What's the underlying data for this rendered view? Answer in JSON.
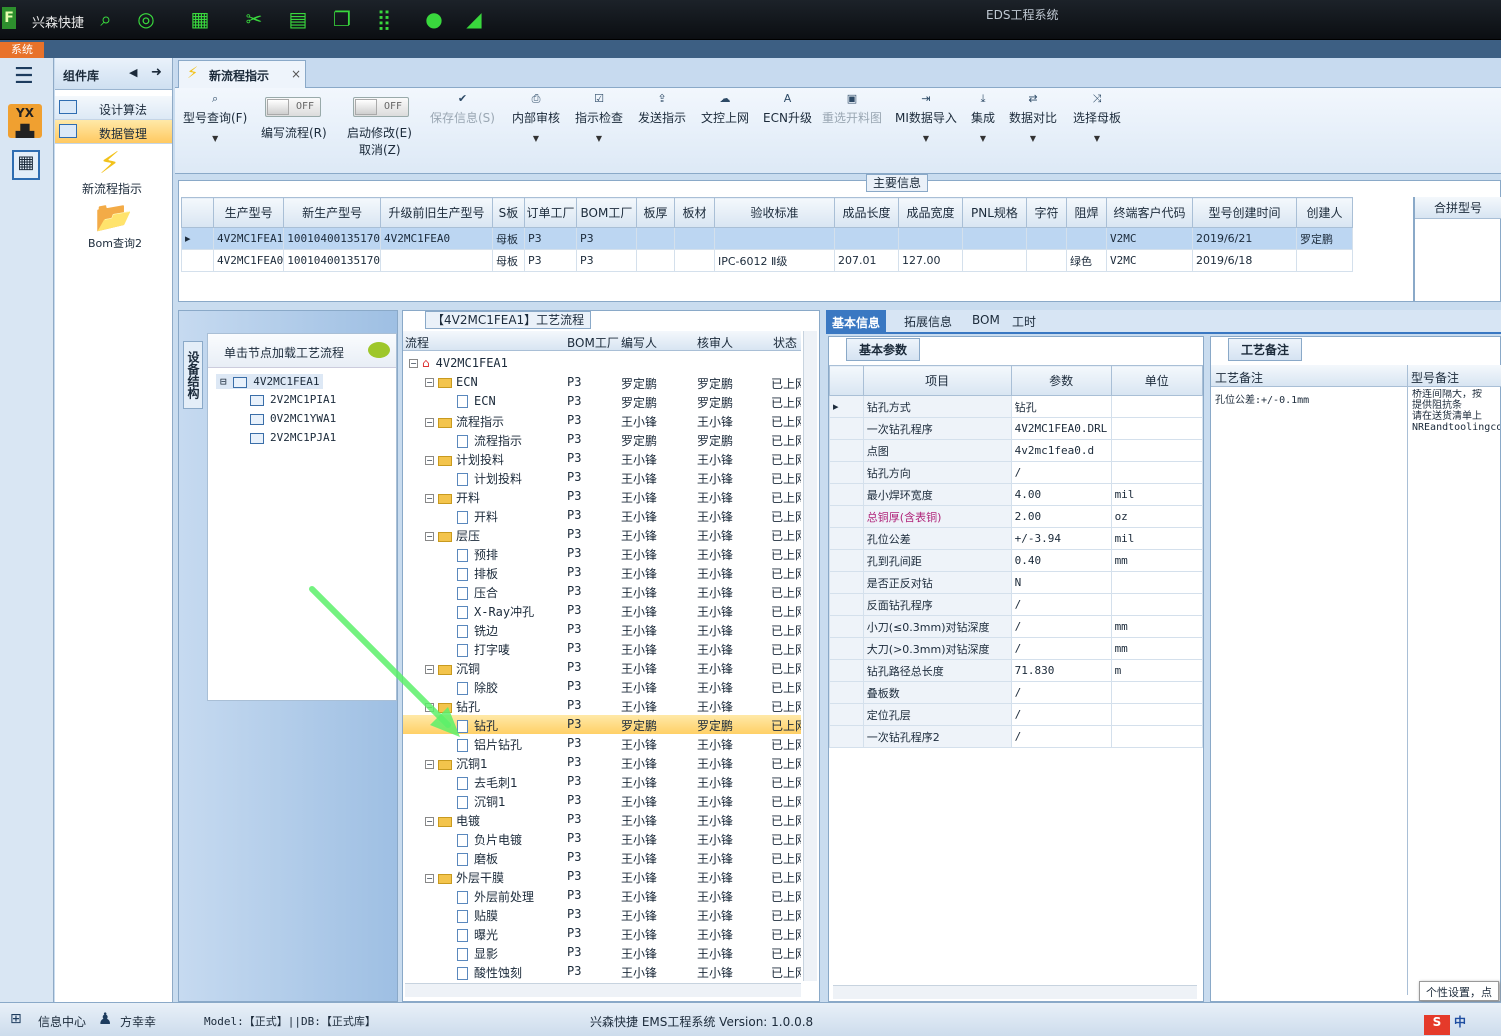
{
  "titlebar": {
    "app_name": "兴森快捷",
    "window_title": "EDS工程系统",
    "logo": "F"
  },
  "system_tab": "系统",
  "library": {
    "title": "组件库",
    "items": [
      {
        "label": "设计算法"
      },
      {
        "label": "数据管理"
      }
    ],
    "big_items": [
      {
        "label": "新流程指示"
      },
      {
        "label": "Bom查询2"
      }
    ]
  },
  "doc_tab": {
    "label": "新流程指示",
    "close": "×"
  },
  "toolbar": {
    "buttons": [
      {
        "label": "型号查询(F)",
        "icon": "search-icon"
      },
      {
        "label": "编写流程(R)",
        "toggle": "OFF"
      },
      {
        "label": "启动修改(E)",
        "label2": "取消(Z)",
        "toggle": "OFF"
      },
      {
        "label": "保存信息(S)",
        "icon": "check-icon",
        "disabled": true
      },
      {
        "label": "内部审核",
        "icon": "printer-icon"
      },
      {
        "label": "指示检查",
        "icon": "checkbox-icon"
      },
      {
        "label": "发送指示",
        "icon": "upload-icon"
      },
      {
        "label": "文控上网",
        "icon": "cloud-upload-icon"
      },
      {
        "label": "ECN升级",
        "icon": "font-a-icon"
      },
      {
        "label": "重选开料图",
        "icon": "image-icon",
        "disabled": true
      },
      {
        "label": "MI数据导入",
        "icon": "import-icon"
      },
      {
        "label": "集成",
        "icon": "download-icon"
      },
      {
        "label": "数据对比",
        "icon": "compare-icon"
      },
      {
        "label": "选择母板",
        "icon": "shuffle-icon"
      }
    ]
  },
  "main_info": {
    "legend": "主要信息",
    "columns": [
      "生产型号",
      "新生产型号",
      "升级前旧生产型号",
      "S板",
      "订单工厂",
      "BOM工厂",
      "板厚",
      "板材",
      "验收标准",
      "成品长度",
      "成品宽度",
      "PNL规格",
      "字符",
      "阻焊",
      "终端客户代码",
      "型号创建时间",
      "创建人"
    ],
    "rows": [
      [
        "4V2MC1FEA1",
        "10010400135170",
        "4V2MC1FEA0",
        "母板",
        "P3",
        "P3",
        "",
        "",
        "",
        "",
        "",
        "",
        "",
        "",
        "V2MC",
        "2019/6/21",
        "罗定鹏"
      ],
      [
        "4V2MC1FEA0",
        "10010400135170",
        "",
        "母板",
        "P3",
        "P3",
        "",
        "",
        "IPC-6012 Ⅱ级",
        "207.01",
        "127.00",
        "",
        "",
        "绿色",
        "V2MC",
        "2019/6/18",
        ""
      ]
    ],
    "merge_header": "合拼型号"
  },
  "device": {
    "tab": "设备结构",
    "hint": "单击节点加载工艺流程",
    "root": "4V2MC1FEA1",
    "children": [
      "2V2MC1PIA1",
      "0V2MC1YWA1",
      "2V2MC1PJA1"
    ]
  },
  "process": {
    "legend": "【4V2MC1FEA1】工艺流程",
    "columns": [
      "流程",
      "BOM工厂",
      "编写人",
      "核审人",
      "状态"
    ],
    "rows": [
      {
        "name": "4V2MC1FEA1",
        "type": "root",
        "bom": "",
        "writer": "",
        "checker": "",
        "status": ""
      },
      {
        "name": "ECN",
        "type": "folder",
        "bom": "P3",
        "writer": "罗定鹏",
        "checker": "罗定鹏",
        "status": "已上网"
      },
      {
        "name": "ECN",
        "type": "doc",
        "bom": "P3",
        "writer": "罗定鹏",
        "checker": "罗定鹏",
        "status": "已上网"
      },
      {
        "name": "流程指示",
        "type": "folder",
        "bom": "P3",
        "writer": "王小锋",
        "checker": "王小锋",
        "status": "已上网"
      },
      {
        "name": "流程指示",
        "type": "doc",
        "bom": "P3",
        "writer": "罗定鹏",
        "checker": "罗定鹏",
        "status": "已上网"
      },
      {
        "name": "计划投料",
        "type": "folder",
        "bom": "P3",
        "writer": "王小锋",
        "checker": "王小锋",
        "status": "已上网"
      },
      {
        "name": "计划投料",
        "type": "doc",
        "bom": "P3",
        "writer": "王小锋",
        "checker": "王小锋",
        "status": "已上网"
      },
      {
        "name": "开料",
        "type": "folder",
        "bom": "P3",
        "writer": "王小锋",
        "checker": "王小锋",
        "status": "已上网"
      },
      {
        "name": "开料",
        "type": "doc",
        "bom": "P3",
        "writer": "王小锋",
        "checker": "王小锋",
        "status": "已上网"
      },
      {
        "name": "层压",
        "type": "folder",
        "bom": "P3",
        "writer": "王小锋",
        "checker": "王小锋",
        "status": "已上网"
      },
      {
        "name": "预排",
        "type": "doc",
        "bom": "P3",
        "writer": "王小锋",
        "checker": "王小锋",
        "status": "已上网"
      },
      {
        "name": "排板",
        "type": "doc",
        "bom": "P3",
        "writer": "王小锋",
        "checker": "王小锋",
        "status": "已上网"
      },
      {
        "name": "压合",
        "type": "doc",
        "bom": "P3",
        "writer": "王小锋",
        "checker": "王小锋",
        "status": "已上网"
      },
      {
        "name": "X-Ray冲孔",
        "type": "doc",
        "bom": "P3",
        "writer": "王小锋",
        "checker": "王小锋",
        "status": "已上网"
      },
      {
        "name": "铣边",
        "type": "doc",
        "bom": "P3",
        "writer": "王小锋",
        "checker": "王小锋",
        "status": "已上网"
      },
      {
        "name": "打字唛",
        "type": "doc",
        "bom": "P3",
        "writer": "王小锋",
        "checker": "王小锋",
        "status": "已上网"
      },
      {
        "name": "沉铜",
        "type": "folder",
        "bom": "P3",
        "writer": "王小锋",
        "checker": "王小锋",
        "status": "已上网"
      },
      {
        "name": "除胶",
        "type": "doc",
        "bom": "P3",
        "writer": "王小锋",
        "checker": "王小锋",
        "status": "已上网"
      },
      {
        "name": "钻孔",
        "type": "folder",
        "bom": "P3",
        "writer": "王小锋",
        "checker": "王小锋",
        "status": "已上网"
      },
      {
        "name": "钻孔",
        "type": "doc",
        "bom": "P3",
        "writer": "罗定鹏",
        "checker": "罗定鹏",
        "status": "已上网",
        "selected": true
      },
      {
        "name": "铝片钻孔",
        "type": "doc",
        "bom": "P3",
        "writer": "王小锋",
        "checker": "王小锋",
        "status": "已上网"
      },
      {
        "name": "沉铜1",
        "type": "folder",
        "bom": "P3",
        "writer": "王小锋",
        "checker": "王小锋",
        "status": "已上网"
      },
      {
        "name": "去毛刺1",
        "type": "doc",
        "bom": "P3",
        "writer": "王小锋",
        "checker": "王小锋",
        "status": "已上网"
      },
      {
        "name": "沉铜1",
        "type": "doc",
        "bom": "P3",
        "writer": "王小锋",
        "checker": "王小锋",
        "status": "已上网"
      },
      {
        "name": "电镀",
        "type": "folder",
        "bom": "P3",
        "writer": "王小锋",
        "checker": "王小锋",
        "status": "已上网"
      },
      {
        "name": "负片电镀",
        "type": "doc",
        "bom": "P3",
        "writer": "王小锋",
        "checker": "王小锋",
        "status": "已上网"
      },
      {
        "name": "磨板",
        "type": "doc",
        "bom": "P3",
        "writer": "王小锋",
        "checker": "王小锋",
        "status": "已上网"
      },
      {
        "name": "外层干膜",
        "type": "folder",
        "bom": "P3",
        "writer": "王小锋",
        "checker": "王小锋",
        "status": "已上网"
      },
      {
        "name": "外层前处理",
        "type": "doc",
        "bom": "P3",
        "writer": "王小锋",
        "checker": "王小锋",
        "status": "已上网"
      },
      {
        "name": "贴膜",
        "type": "doc",
        "bom": "P3",
        "writer": "王小锋",
        "checker": "王小锋",
        "status": "已上网"
      },
      {
        "name": "曝光",
        "type": "doc",
        "bom": "P3",
        "writer": "王小锋",
        "checker": "王小锋",
        "status": "已上网"
      },
      {
        "name": "显影",
        "type": "doc",
        "bom": "P3",
        "writer": "王小锋",
        "checker": "王小锋",
        "status": "已上网"
      },
      {
        "name": "酸性蚀刻",
        "type": "doc",
        "bom": "P3",
        "writer": "王小锋",
        "checker": "王小锋",
        "status": "已上网"
      }
    ]
  },
  "right_tabs": [
    "基本信息",
    "拓展信息",
    "BOM",
    "工时"
  ],
  "params": {
    "subtab": "基本参数",
    "columns": [
      "项目",
      "参数",
      "单位"
    ],
    "rows": [
      [
        "钻孔方式",
        "钻孔",
        ""
      ],
      [
        "一次钻孔程序",
        "4V2MC1FEA0.DRL",
        ""
      ],
      [
        "点图",
        "4v2mc1fea0.d",
        ""
      ],
      [
        "钻孔方向",
        "/",
        ""
      ],
      [
        "最小焊环宽度",
        "4.00",
        "mil"
      ],
      [
        "总铜厚(含表铜)",
        "2.00",
        "oz"
      ],
      [
        "孔位公差",
        "+/-3.94",
        "mil"
      ],
      [
        "孔到孔间距",
        "0.40",
        "mm"
      ],
      [
        "是否正反对钻",
        "N",
        ""
      ],
      [
        "反面钻孔程序",
        "/",
        ""
      ],
      [
        "小刀(≤0.3mm)对钻深度",
        "/",
        "mm"
      ],
      [
        "大刀(>0.3mm)对钻深度",
        "/",
        "mm"
      ],
      [
        "钻孔路径总长度",
        "71.830",
        "m"
      ],
      [
        "叠板数",
        "/",
        ""
      ],
      [
        "定位孔层",
        "/",
        ""
      ],
      [
        "一次钻孔程序2",
        "/",
        ""
      ]
    ],
    "highlight_color": "#b0247a"
  },
  "notes": {
    "subtab": "工艺备注",
    "columns": [
      "工艺备注",
      "型号备注"
    ],
    "process_note": "孔位公差:+/-0.1mm",
    "model_note": [
      "桥连间隔大，按",
      "提供阻抗条",
      "请在送货清单上",
      "NREandtoolingco"
    ],
    "popup": "个性设置，点"
  },
  "statusbar": {
    "info_center": "信息中心",
    "user": "方幸幸",
    "model": "Model:【正式】||DB:【正式库】",
    "version": "兴森快捷 EMS工程系统 Version: 1.0.0.8",
    "ime": "中"
  }
}
